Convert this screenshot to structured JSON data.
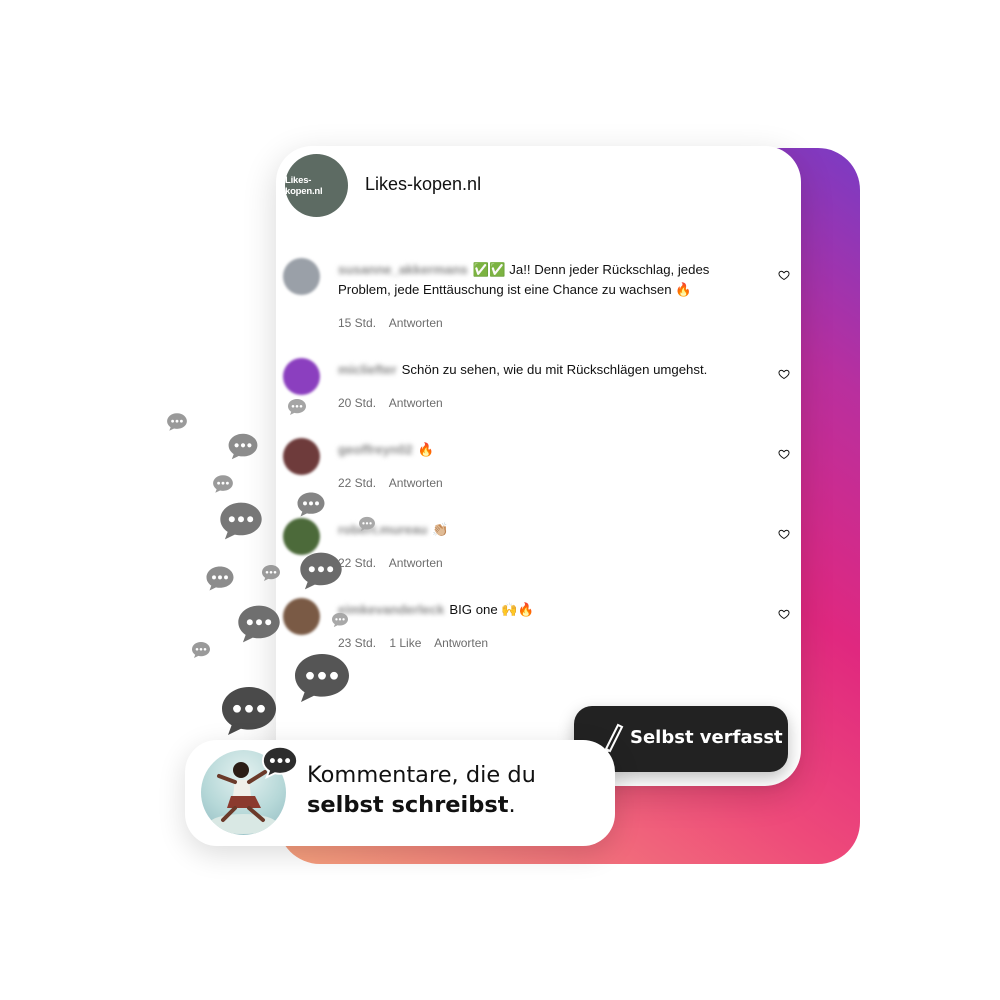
{
  "profile": {
    "avatar_text": "Likes-kopen.nl",
    "name": "Likes-kopen.nl"
  },
  "comments": [
    {
      "username": "susanne_akkermans",
      "text": "✅✅ Ja!! Denn jeder Rückschlag, jedes Problem, jede Enttäuschung ist eine Chance zu wachsen 🔥",
      "time": "15 Std.",
      "likes": "",
      "reply": "Antworten",
      "avatar_color": "#8a8f98"
    },
    {
      "username": "micliefter",
      "text": "Schön zu sehen, wie du mit Rückschlägen umgehst.",
      "time": "20 Std.",
      "likes": "",
      "reply": "Antworten",
      "avatar_color": "#8b3fbf"
    },
    {
      "username": "geoffreyn02",
      "text": "🔥",
      "time": "22 Std.",
      "likes": "",
      "reply": "Antworten",
      "avatar_color": "#6e3b3b"
    },
    {
      "username": "robert.mureau",
      "text": "👏🏼",
      "time": "22 Std.",
      "likes": "",
      "reply": "Antworten",
      "avatar_color": "#4c6a3a"
    },
    {
      "username": "eimkevanderleck",
      "text": "BIG one 🙌🔥",
      "time": "23 Std.",
      "likes": "1 Like",
      "reply": "Antworten",
      "avatar_color": "#7a5a45"
    }
  ],
  "icons": {
    "heart": "heart-icon",
    "bubble": "chat-bubble-icon",
    "pen": "signature-pen-icon"
  },
  "banner": {
    "line1": "Kommentare, die du",
    "line2_bold": "selbst schreibst",
    "line2_end": "."
  },
  "badge": {
    "label": "Selbst verfasst"
  },
  "colors": {
    "gradient_start": "#f6a27d",
    "gradient_mid": "#e0287f",
    "gradient_end": "#7a3bc4",
    "badge_bg": "#222222",
    "bubble": "#555555"
  }
}
